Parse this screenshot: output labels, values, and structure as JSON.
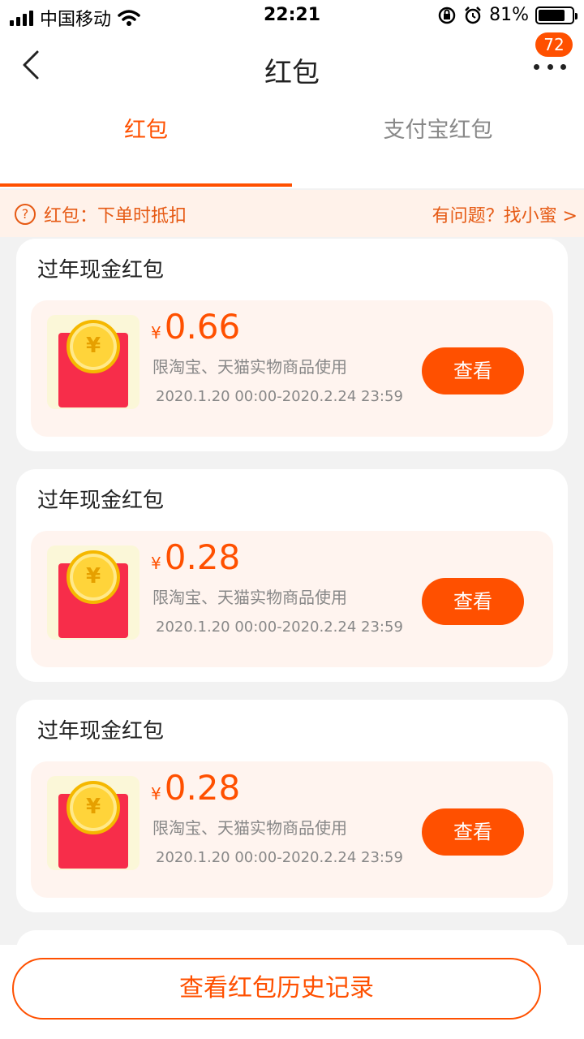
{
  "status_bar": {
    "carrier": "中国移动",
    "time": "22:21",
    "battery": "81%",
    "battery_level": 0.81
  },
  "nav": {
    "title": "红包",
    "badge": "72"
  },
  "tabs": [
    {
      "label": "红包",
      "active": true
    },
    {
      "label": "支付宝红包",
      "active": false
    }
  ],
  "notice": {
    "left_text": "红包：下单时抵扣",
    "right_text": "有问题？找小蜜 >"
  },
  "cards": [
    {
      "title": "过年现金红包",
      "currency": "¥",
      "amount": "0.66",
      "usage": "限淘宝、天猫实物商品使用",
      "dates": "2020.1.20 00:00-2020.2.24 23:59",
      "button": "查看"
    },
    {
      "title": "过年现金红包",
      "currency": "¥",
      "amount": "0.28",
      "usage": "限淘宝、天猫实物商品使用",
      "dates": "2020.1.20 00:00-2020.2.24 23:59",
      "button": "查看"
    },
    {
      "title": "过年现金红包",
      "currency": "¥",
      "amount": "0.28",
      "usage": "限淘宝、天猫实物商品使用",
      "dates": "2020.1.20 00:00-2020.2.24 23:59",
      "button": "查看"
    }
  ],
  "footer": {
    "history_button": "查看红包历史记录"
  },
  "colors": {
    "accent": "#ff5000",
    "notice_bg": "#fff2ea",
    "card_inner_bg": "#fff4ef",
    "envelope": "#f72d4a",
    "coin": "#ffd43a"
  }
}
